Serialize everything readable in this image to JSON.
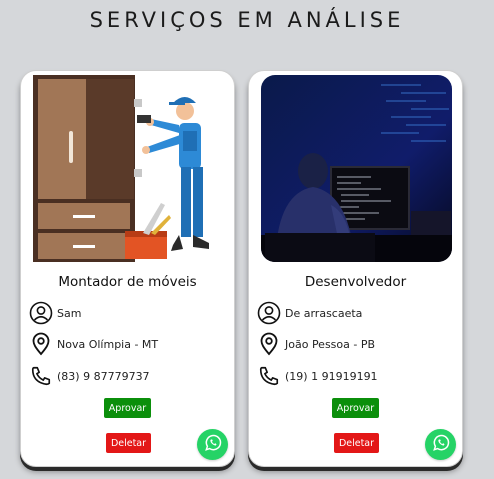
{
  "page": {
    "title": "SERVIÇOS EM ANÁLISE"
  },
  "cards": [
    {
      "title": "Montador de móveis",
      "name": "Sam",
      "city": "Nova Olímpia - MT",
      "phone": "(83) 9 87779737",
      "approve_label": "Aprovar",
      "delete_label": "Deletar",
      "image_icon": "furniture-assembler-illustration"
    },
    {
      "title": "Desenvolvedor",
      "name": "De arrascaeta",
      "city": "João Pessoa - PB",
      "phone": "(19) 1 91919191",
      "approve_label": "Aprovar",
      "delete_label": "Deletar",
      "image_icon": "developer-photo"
    }
  ],
  "colors": {
    "approve": "#0b8f0b",
    "delete": "#e31717",
    "whatsapp": "#25d366",
    "background": "#d5d7da"
  }
}
